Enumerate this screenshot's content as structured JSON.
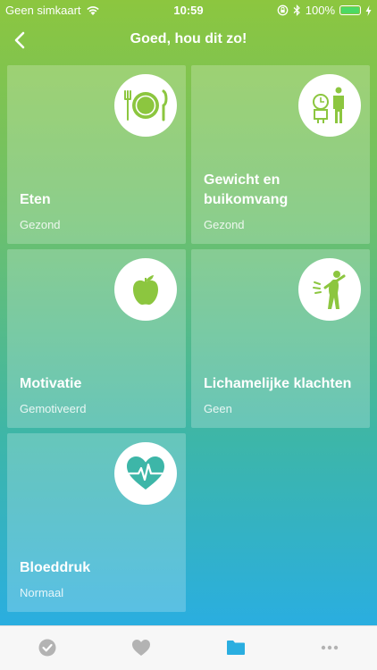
{
  "status_bar": {
    "carrier": "Geen simkaart",
    "time": "10:59",
    "battery_percent": "100%",
    "battery_level": 1.0
  },
  "nav": {
    "title": "Goed, hou dit zo!",
    "back_icon": "chevron-left-icon"
  },
  "tiles": [
    {
      "title": "Eten",
      "subtitle": "Gezond",
      "icon": "plate-cutlery-icon"
    },
    {
      "title": "Gewicht en buikomvang",
      "subtitle": "Gezond",
      "icon": "scale-person-icon"
    },
    {
      "title": "Motivatie",
      "subtitle": "Gemotiveerd",
      "icon": "apple-icon"
    },
    {
      "title": "Lichamelijke klachten",
      "subtitle": "Geen",
      "icon": "pain-person-icon"
    },
    {
      "title": "Bloeddruk",
      "subtitle": "Normaal",
      "icon": "heart-pulse-icon"
    }
  ],
  "tab_bar": {
    "tabs": [
      {
        "icon": "check-circle-icon",
        "active": false
      },
      {
        "icon": "heart-icon",
        "active": false
      },
      {
        "icon": "folder-icon",
        "active": true
      },
      {
        "icon": "more-icon",
        "active": false
      }
    ]
  },
  "colors": {
    "gradient_top": "#8cc63f",
    "gradient_bottom": "#2aaee0",
    "icon_color": "#8cc63f",
    "tab_active": "#2aaee0",
    "tab_inactive": "#b3b3b3"
  }
}
